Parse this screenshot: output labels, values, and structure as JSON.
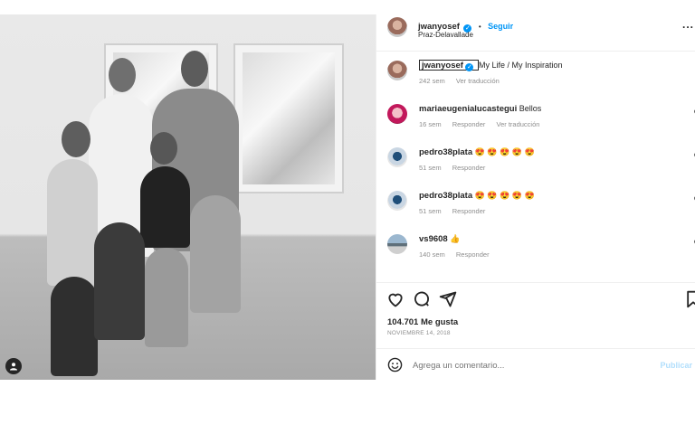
{
  "header": {
    "username": "jwanyosef",
    "separator": "•",
    "follow_label": "Seguir",
    "location": "Praz-Delavallade",
    "more_label": "..."
  },
  "caption": {
    "username": "jwanyosef",
    "text": "My Life / My Inspiration",
    "time": "242 sem",
    "translate": "Ver traducción"
  },
  "comments": [
    {
      "username": "mariaeugenialucastegui",
      "text": "Bellos",
      "time": "16 sem",
      "reply": "Responder",
      "translate": "Ver traducción"
    },
    {
      "username": "pedro38plata",
      "text": "😍 😍 😍 😍 😍",
      "time": "51 sem",
      "reply": "Responder"
    },
    {
      "username": "pedro38plata",
      "text": "😍 😍 😍 😍 😍",
      "time": "51 sem",
      "reply": "Responder"
    },
    {
      "username": "vs9608",
      "text": "👍",
      "time": "140 sem",
      "reply": "Responder"
    }
  ],
  "stats": {
    "likes": "104.701 Me gusta",
    "date": "NOVIEMBRE 14, 2018"
  },
  "composer": {
    "placeholder": "Agrega un comentario...",
    "publish_label": "Publicar"
  },
  "icons": {
    "like": "heart-icon",
    "comment": "comment-icon",
    "share": "share-icon",
    "save": "bookmark-icon",
    "emoji": "emoji-icon",
    "tagged": "user-tag-icon",
    "more": "more-options-icon"
  },
  "colors": {
    "accent": "#0095f6",
    "text": "#262626",
    "muted": "#8e8e8e",
    "border": "#efefef"
  }
}
